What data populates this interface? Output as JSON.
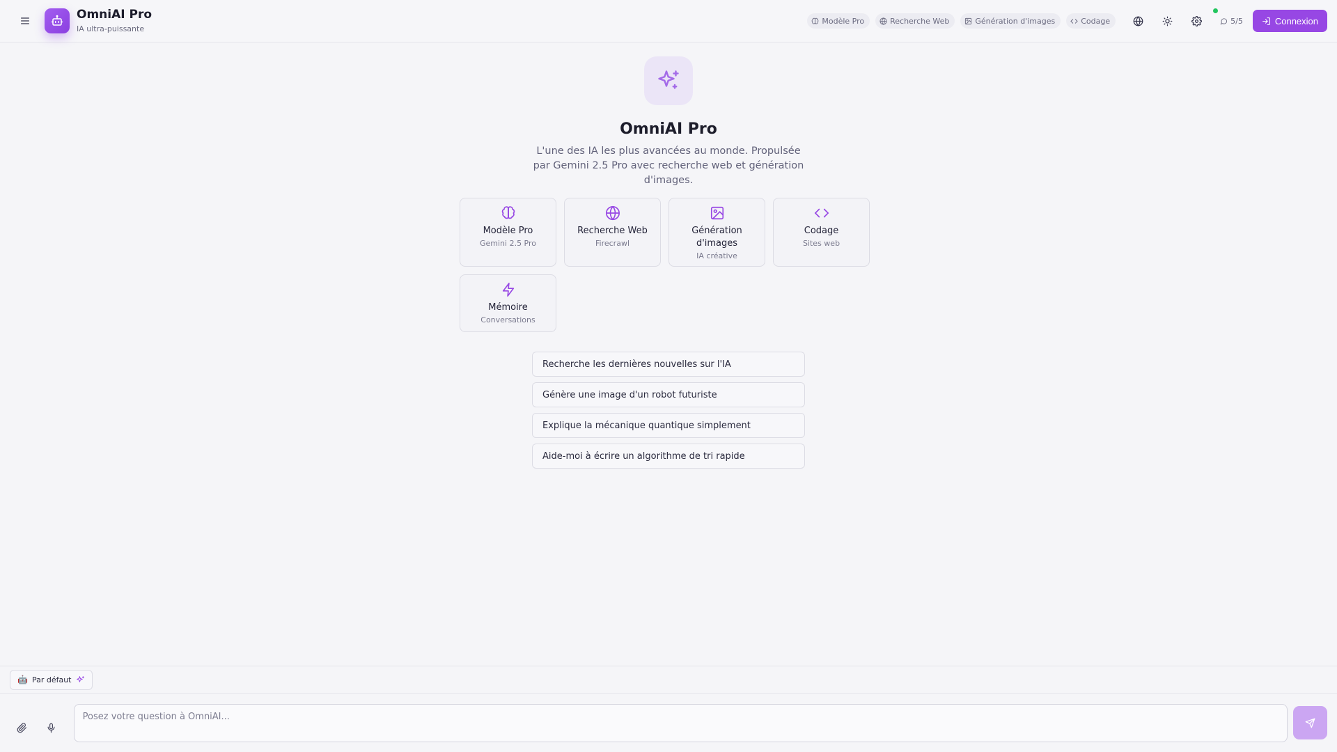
{
  "header": {
    "brand_title": "OmniAI Pro",
    "brand_subtitle": "IA ultra-puissante",
    "chips": [
      {
        "label": "Modèle Pro",
        "icon": "brain-icon"
      },
      {
        "label": "Recherche Web",
        "icon": "globe-icon"
      },
      {
        "label": "Génération d'images",
        "icon": "image-icon"
      },
      {
        "label": "Codage",
        "icon": "code-icon"
      }
    ],
    "counter": "5/5",
    "login_label": "Connexion"
  },
  "hero": {
    "title": "OmniAI Pro",
    "description": "L'une des IA les plus avancées au monde. Propulsée par Gemini 2.5 Pro avec recherche web et génération d'images."
  },
  "features": [
    {
      "title": "Modèle Pro",
      "subtitle": "Gemini 2.5 Pro",
      "icon": "brain-icon"
    },
    {
      "title": "Recherche Web",
      "subtitle": "Firecrawl",
      "icon": "globe-icon"
    },
    {
      "title": "Génération d'images",
      "subtitle": "IA créative",
      "icon": "image-icon"
    },
    {
      "title": "Codage",
      "subtitle": "Sites web",
      "icon": "code-icon"
    },
    {
      "title": "Mémoire",
      "subtitle": "Conversations",
      "icon": "zap-icon"
    }
  ],
  "suggestions": [
    "Recherche les dernières nouvelles sur l'IA",
    "Génère une image d'un robot futuriste",
    "Explique la mécanique quantique simplement",
    "Aide-moi à écrire un algorithme de tri rapide"
  ],
  "persona": {
    "emoji": "🤖",
    "label": "Par défaut"
  },
  "composer": {
    "placeholder": "Posez votre question à OmniAI..."
  },
  "colors": {
    "accent": "#9747e4",
    "accent_soft": "#cba6f2",
    "status_online": "#22c55e"
  }
}
